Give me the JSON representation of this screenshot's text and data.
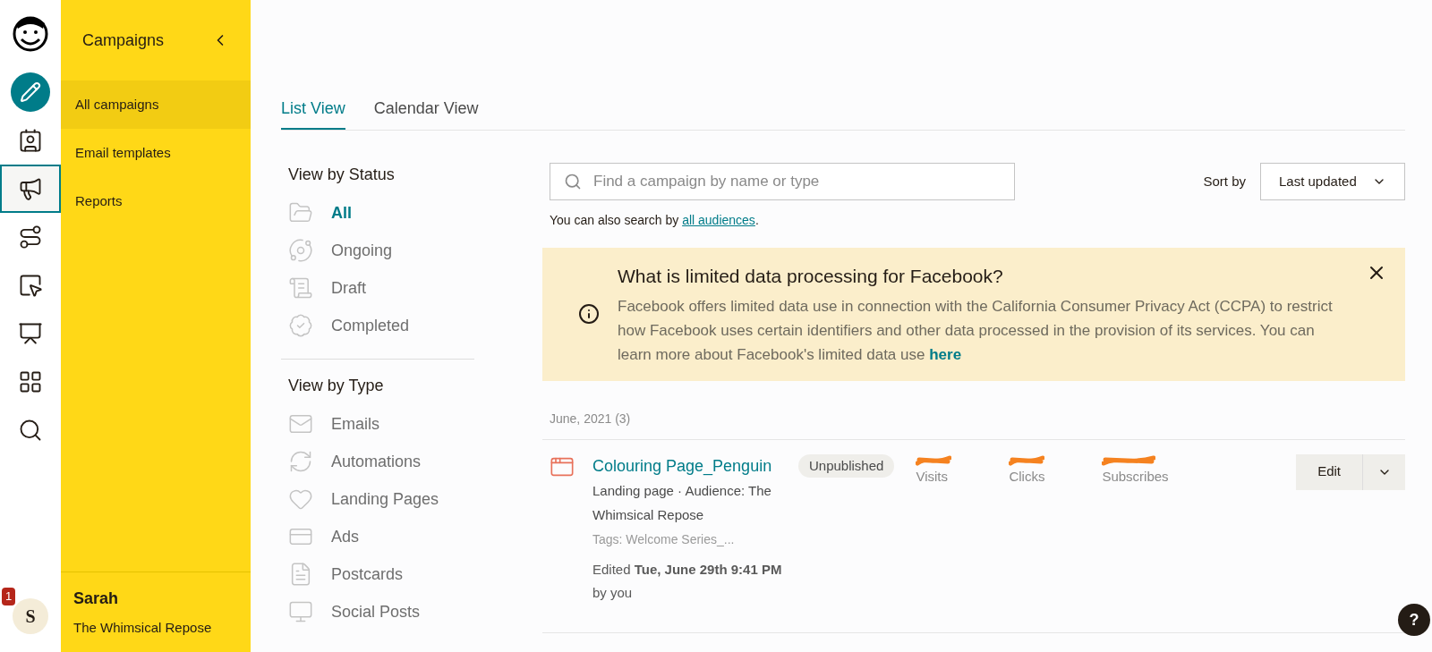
{
  "rail": {
    "items": [
      {
        "kind": "create",
        "selected": false
      },
      {
        "kind": "audience",
        "selected": false
      },
      {
        "kind": "campaigns",
        "selected": true
      },
      {
        "kind": "automations",
        "selected": false
      },
      {
        "kind": "website",
        "selected": false
      },
      {
        "kind": "content",
        "selected": false
      },
      {
        "kind": "integrations",
        "selected": false
      },
      {
        "kind": "search",
        "selected": false
      }
    ],
    "notification_count": "1",
    "avatar_letter": "S"
  },
  "sidebar": {
    "title": "Campaigns",
    "items": [
      {
        "label": "All campaigns",
        "selected": true
      },
      {
        "label": "Email templates",
        "selected": false
      },
      {
        "label": "Reports",
        "selected": false
      }
    ],
    "user_name": "Sarah",
    "org_name": "The Whimsical Repose"
  },
  "tabs": [
    {
      "label": "List View",
      "selected": true
    },
    {
      "label": "Calendar View",
      "selected": false
    }
  ],
  "filters": {
    "status_title": "View by Status",
    "status": [
      {
        "label": "All",
        "kind": "all",
        "selected": true
      },
      {
        "label": "Ongoing",
        "kind": "ongoing",
        "selected": false
      },
      {
        "label": "Draft",
        "kind": "draft",
        "selected": false
      },
      {
        "label": "Completed",
        "kind": "completed",
        "selected": false
      }
    ],
    "type_title": "View by Type",
    "types": [
      {
        "label": "Emails",
        "kind": "emails",
        "selected": false
      },
      {
        "label": "Automations",
        "kind": "automations",
        "selected": false
      },
      {
        "label": "Landing Pages",
        "kind": "landing",
        "selected": false
      },
      {
        "label": "Ads",
        "kind": "ads",
        "selected": false
      },
      {
        "label": "Postcards",
        "kind": "postcards",
        "selected": false
      },
      {
        "label": "Social Posts",
        "kind": "social",
        "selected": false
      }
    ]
  },
  "search": {
    "placeholder": "Find a campaign by name or type",
    "hint": "You can also search by",
    "hint_link": "all audiences",
    "hint_end": "."
  },
  "sort": {
    "label": "Sort by",
    "value": "Last updated"
  },
  "banner": {
    "title": "What is limited data processing for Facebook?",
    "body": "Facebook offers limited data use in connection with the California Consumer Privacy Act (CCPA) to restrict how Facebook uses certain identifiers and other data processed in the provision of its services. You can learn more about Facebook's limited data use",
    "link": "here"
  },
  "group": {
    "heading": "June, 2021 (3)",
    "campaigns": [
      {
        "name": "Colouring Page_Penguin",
        "status": "Unpublished",
        "meta": "Landing page · Audience: The Whimsical Repose",
        "tags": "Tags: Welcome Series_...",
        "edited": "Edited **Tue, June 29th 9:41 PM**",
        "by": "by you",
        "stats": [
          "Visits",
          "Clicks",
          "Subscribes"
        ],
        "action": "Edit"
      }
    ]
  },
  "help": "?"
}
